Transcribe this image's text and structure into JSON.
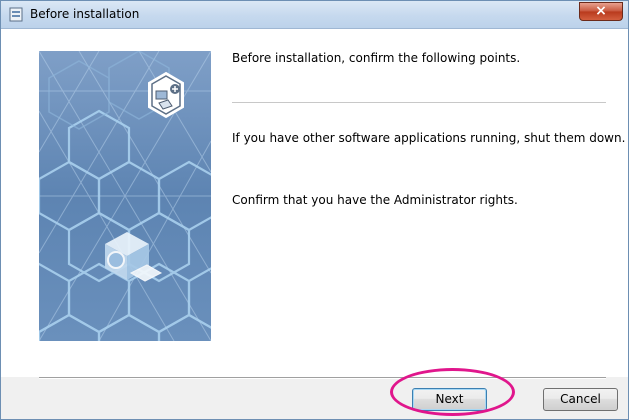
{
  "window": {
    "title": "Before installation",
    "close_glyph": "×",
    "app_icon": "installer-icon"
  },
  "content": {
    "line1": "Before installation, confirm the following points.",
    "line2": "If you have other software applications running, shut them down.",
    "line3": "Confirm that you have the Administrator rights."
  },
  "buttons": {
    "next": "Next",
    "cancel": "Cancel"
  },
  "colors": {
    "highlight": "#e0168c",
    "illustration_bg": "#5f86b4",
    "hex_lines": "#a9d0ee"
  }
}
